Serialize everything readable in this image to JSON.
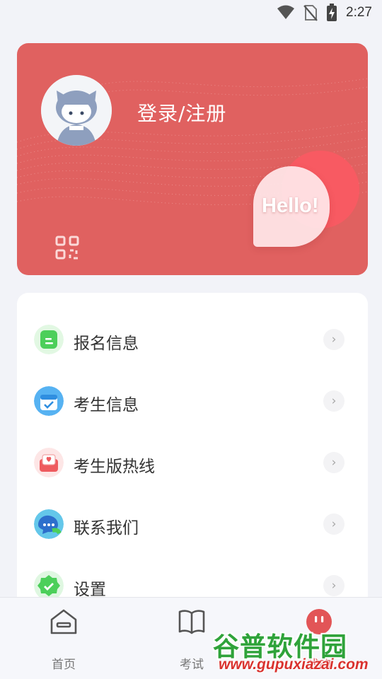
{
  "status_bar": {
    "time": "2:27",
    "icons": [
      "wifi-icon",
      "no-sim-icon",
      "battery-charging-icon"
    ]
  },
  "profile": {
    "login_label": "登录/注册",
    "hello_text": "Hello!",
    "icons": [
      "avatar-icon",
      "qr-code-icon"
    ],
    "colors": {
      "card_bg": "#e06160",
      "hello_circle": "#f85a62"
    }
  },
  "menu": {
    "items": [
      {
        "label": "报名信息",
        "icon": "registration-info-icon"
      },
      {
        "label": "考生信息",
        "icon": "candidate-info-icon"
      },
      {
        "label": "考生版热线",
        "icon": "hotline-icon"
      },
      {
        "label": "联系我们",
        "icon": "contact-us-icon"
      },
      {
        "label": "设置",
        "icon": "settings-icon"
      }
    ]
  },
  "bottom_nav": {
    "items": [
      {
        "label": "首页",
        "icon": "home-icon"
      },
      {
        "label": "考试",
        "icon": "book-icon"
      },
      {
        "label": "我的",
        "icon": "profile-icon",
        "active": true
      }
    ]
  },
  "watermark": {
    "title": "谷普软件园",
    "url": "www.gupuxiazai.com"
  },
  "colors": {
    "background": "#f2f3f8",
    "accent": "#e25557",
    "text": "#333333"
  }
}
